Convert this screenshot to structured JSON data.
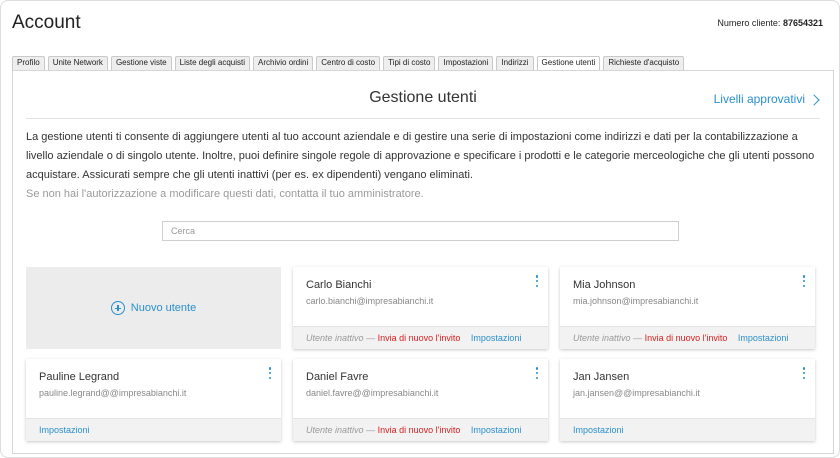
{
  "header": {
    "title": "Account",
    "client_label": "Numero cliente:",
    "client_number": "87654321"
  },
  "tabs": [
    {
      "label": "Profilo",
      "active": false
    },
    {
      "label": "Unite Network",
      "active": false
    },
    {
      "label": "Gestione viste",
      "active": false
    },
    {
      "label": "Liste degli acquisti",
      "active": false
    },
    {
      "label": "Archivio ordini",
      "active": false
    },
    {
      "label": "Centro di costo",
      "active": false
    },
    {
      "label": "Tipi di costo",
      "active": false
    },
    {
      "label": "Impostazioni",
      "active": false
    },
    {
      "label": "Indirizzi",
      "active": false
    },
    {
      "label": "Gestione utenti",
      "active": true
    },
    {
      "label": "Richieste d'acquisto",
      "active": false
    }
  ],
  "section": {
    "title": "Gestione utenti",
    "approval_link": "Livelli approvativi"
  },
  "description": {
    "main": "La gestione utenti ti consente di aggiungere utenti al tuo account aziendale e di gestire una serie di impostazioni come indirizzi e dati per la contabilizzazione a livello aziendale o di singolo utente. Inoltre, puoi definire singole regole di approvazione e specificare i prodotti e le categorie merceologiche che gli utenti possono acquistare. Assicurati sempre che gli utenti inattivi (per es. ex dipendenti) vengano eliminati.",
    "note": "Se non hai l'autorizzazione a modificare questi dati, contatta il tuo amministratore."
  },
  "search": {
    "placeholder": "Cerca",
    "value": ""
  },
  "new_user": {
    "label": "Nuovo utente",
    "icon": "plus-circle-icon"
  },
  "users": [
    {
      "name": "Carlo Bianchi",
      "email": "carlo.bianchi@impresabianchi.it",
      "inactive": true
    },
    {
      "name": "Mia Johnson",
      "email": "mia.johnson@impresabianchi.it",
      "inactive": true
    },
    {
      "name": "Pauline Legrand",
      "email": "pauline.legrand@@impresabianchi.it",
      "inactive": false
    },
    {
      "name": "Daniel Favre",
      "email": "daniel.favre@@impresabianchi.it",
      "inactive": true
    },
    {
      "name": "Jan Jansen",
      "email": "jan.jansen@@impresabianchi.it",
      "inactive": false
    }
  ],
  "card_labels": {
    "inactive": "Utente inattivo",
    "dash": "—",
    "resend": "Invia di nuovo l'invito",
    "settings": "Impostazioni"
  },
  "colors": {
    "accent": "#2a8fcf",
    "warning": "#d62020",
    "muted": "#9a9a9a"
  }
}
